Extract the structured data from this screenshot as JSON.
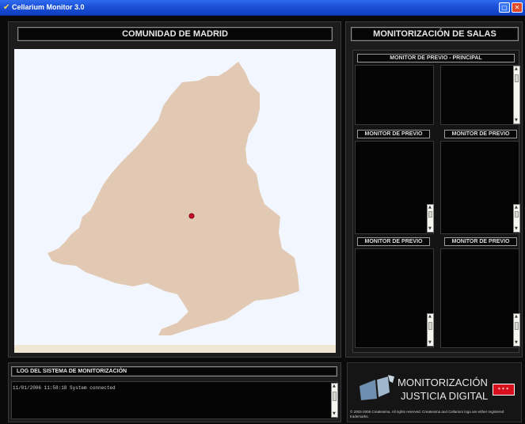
{
  "window": {
    "title": "Cellarium Monitor 3.0"
  },
  "map_panel": {
    "header": "COMUNIDAD DE MADRID"
  },
  "rooms_panel": {
    "header": "MONITORIZACIÓN DE SALAS",
    "main_monitor_label": "MONITOR DE PREVIO - PRINCIPAL",
    "monitor_labels": [
      "MONITOR DE PREVIO",
      "MONITOR DE PREVIO",
      "MONITOR DE PREVIO",
      "MONITOR DE PREVIO"
    ]
  },
  "log_panel": {
    "header": "LOG DEL SISTEMA DE MONITORIZACIÓN",
    "entries": [
      "11/01/2006 11:58:18 System connected"
    ]
  },
  "branding": {
    "line1": "MONITORIZACIÓN",
    "line2": "JUSTICIA DIGITAL",
    "copyright": "© 2003-2006 Createsima. All rights reserved. Createsima and Cellarium logo are either registered trademarks."
  },
  "colors": {
    "map_fill": "#e2c9b3",
    "marker": "#c8102e",
    "titlebar": "#1f55e0"
  }
}
